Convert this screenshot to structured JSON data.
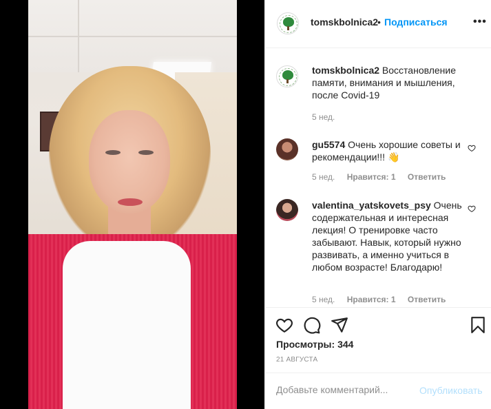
{
  "post": {
    "account": "tomskbolnica2",
    "follow_label": "Подписаться",
    "separator": "•",
    "more_label": "•••"
  },
  "caption": {
    "username": "tomskbolnica2",
    "text": "Восстановление памяти, внимания и мышления, после Covid-19",
    "time": "5 нед."
  },
  "comments": [
    {
      "username": "gu5574",
      "text": "Очень хорошие советы и рекомендации!!! 👋",
      "time": "5 нед.",
      "likes": "Нравится: 1",
      "reply": "Ответить"
    },
    {
      "username": "valentina_yatskovets_psy",
      "text": "Очень содержательная и интересная лекция! О тренировке часто забывают. Навык, который нужно развивать, а именно учиться в любом возрасте! Благодарю!",
      "time": "5 нед.",
      "likes": "Нравится: 1",
      "reply": "Ответить"
    }
  ],
  "stats": {
    "views_label": "Просмотры:",
    "views_value": "344",
    "date": "21 АВГУСТА"
  },
  "composer": {
    "placeholder": "Добавьте комментарий...",
    "post_label": "Опубликовать"
  },
  "icons": {
    "like": "heart-icon",
    "comment": "comment-icon",
    "share": "share-icon",
    "save": "bookmark-icon",
    "more": "more-icon",
    "logo": "hospital-tree-logo"
  },
  "colors": {
    "accent": "#0095f6",
    "post_disabled": "#b2dffc",
    "secondary_text": "#8e8e8e"
  }
}
